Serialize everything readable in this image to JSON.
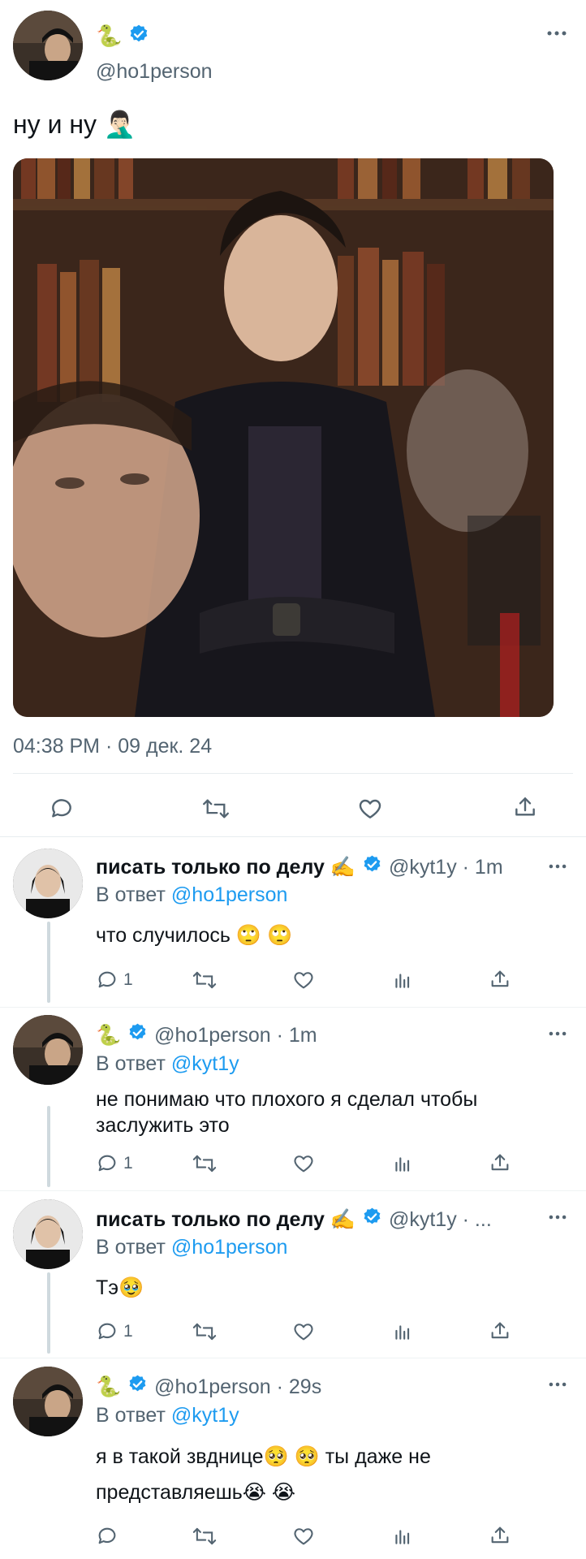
{
  "main_tweet": {
    "display_name": "🐍",
    "handle": "@ho1person",
    "text": "ну и ну 🤦🏻‍♂️",
    "timestamp": "04:38 PM · 09 дек. 24",
    "more_icon": "more-icon",
    "actions": [
      "reply-icon",
      "retweet-icon",
      "like-icon",
      "share-icon"
    ]
  },
  "replies": [
    {
      "display_name": "писать только по делу ✍️",
      "handle_time": "@kyt1y · 1m",
      "reply_prefix": "В ответ",
      "reply_to": "@ho1person",
      "text": "что случилось 🙄 🙄",
      "reply_count": "1"
    },
    {
      "display_name": "🐍",
      "handle_time": "@ho1person · 1m",
      "reply_prefix": "В ответ",
      "reply_to": "@kyt1y",
      "text_line1": "не понимаю что плохого я сделал чтобы",
      "text_line2": "заслужить это",
      "reply_count": "1"
    },
    {
      "display_name": "писать только по делу ✍️",
      "handle_time": "@kyt1y · ...",
      "reply_prefix": "В ответ",
      "reply_to": "@ho1person",
      "text": "Тэ🥹",
      "reply_count": "1"
    },
    {
      "display_name": "🐍",
      "handle_time": "@ho1person · 29s",
      "reply_prefix": "В ответ",
      "reply_to": "@kyt1y",
      "text_line1": "я в такой звднице🥺 🥺  ты даже не",
      "text_line2": "представляешь😭 😭"
    }
  ],
  "colors": {
    "accent": "#1d9bf0",
    "muted": "#536471",
    "divider": "#e7ecef"
  }
}
